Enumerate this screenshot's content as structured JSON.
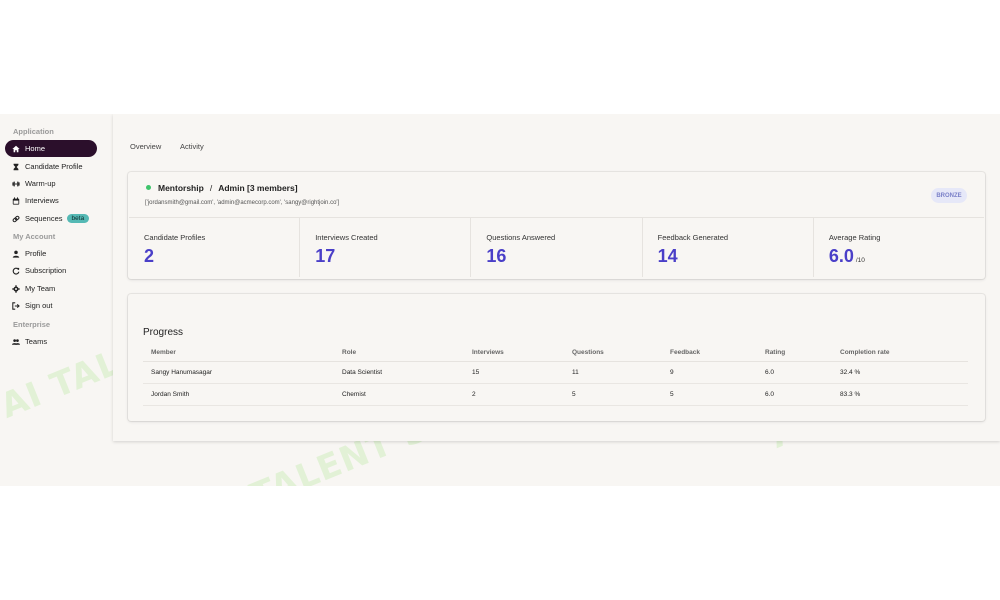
{
  "watermark": "AI TALENT SPACE",
  "sidebar": {
    "sections": [
      {
        "title": "Application",
        "items": [
          {
            "label": "Home",
            "icon": "home-icon",
            "active": true
          },
          {
            "label": "Candidate Profile",
            "icon": "hourglass-icon"
          },
          {
            "label": "Warm-up",
            "icon": "dumbbell-icon"
          },
          {
            "label": "Interviews",
            "icon": "calendar-icon"
          },
          {
            "label": "Sequences",
            "icon": "link-icon",
            "badge": "beta"
          }
        ]
      },
      {
        "title": "My Account",
        "items": [
          {
            "label": "Profile",
            "icon": "user-icon"
          },
          {
            "label": "Subscription",
            "icon": "refresh-icon"
          },
          {
            "label": "My Team",
            "icon": "gear-icon"
          },
          {
            "label": "Sign out",
            "icon": "sign-out-icon"
          }
        ]
      },
      {
        "title": "Enterprise",
        "items": [
          {
            "label": "Teams",
            "icon": "users-icon"
          }
        ]
      }
    ]
  },
  "tabs": [
    {
      "label": "Overview"
    },
    {
      "label": "Activity"
    }
  ],
  "org": {
    "name": "Mentorship",
    "separator": "/",
    "role": "Admin [3 members]",
    "emails": "['jordansmith@gmail.com', 'admin@acmecorp.com', 'sangy@rightjoin.co']",
    "tier": "BRONZE",
    "status_color": "#3ec46b"
  },
  "stats": [
    {
      "label": "Candidate Profiles",
      "value": "2"
    },
    {
      "label": "Interviews Created",
      "value": "17"
    },
    {
      "label": "Questions Answered",
      "value": "16"
    },
    {
      "label": "Feedback Generated",
      "value": "14"
    },
    {
      "label": "Average Rating",
      "value": "6.0",
      "unit": "/10"
    }
  ],
  "progress": {
    "title": "Progress",
    "columns": [
      "Member",
      "Role",
      "Interviews",
      "Questions",
      "Feedback",
      "Rating",
      "Completion rate"
    ],
    "rows": [
      [
        "Sangy Hanumasagar",
        "Data Scientist",
        "15",
        "11",
        "9",
        "6.0",
        "32.4 %"
      ],
      [
        "Jordan Smith",
        "Chemist",
        "2",
        "5",
        "5",
        "6.0",
        "83.3 %"
      ]
    ]
  },
  "colors": {
    "accent": "#4a3fc8",
    "nav_active": "#2b0f2b",
    "badge": "#55b9b4"
  }
}
